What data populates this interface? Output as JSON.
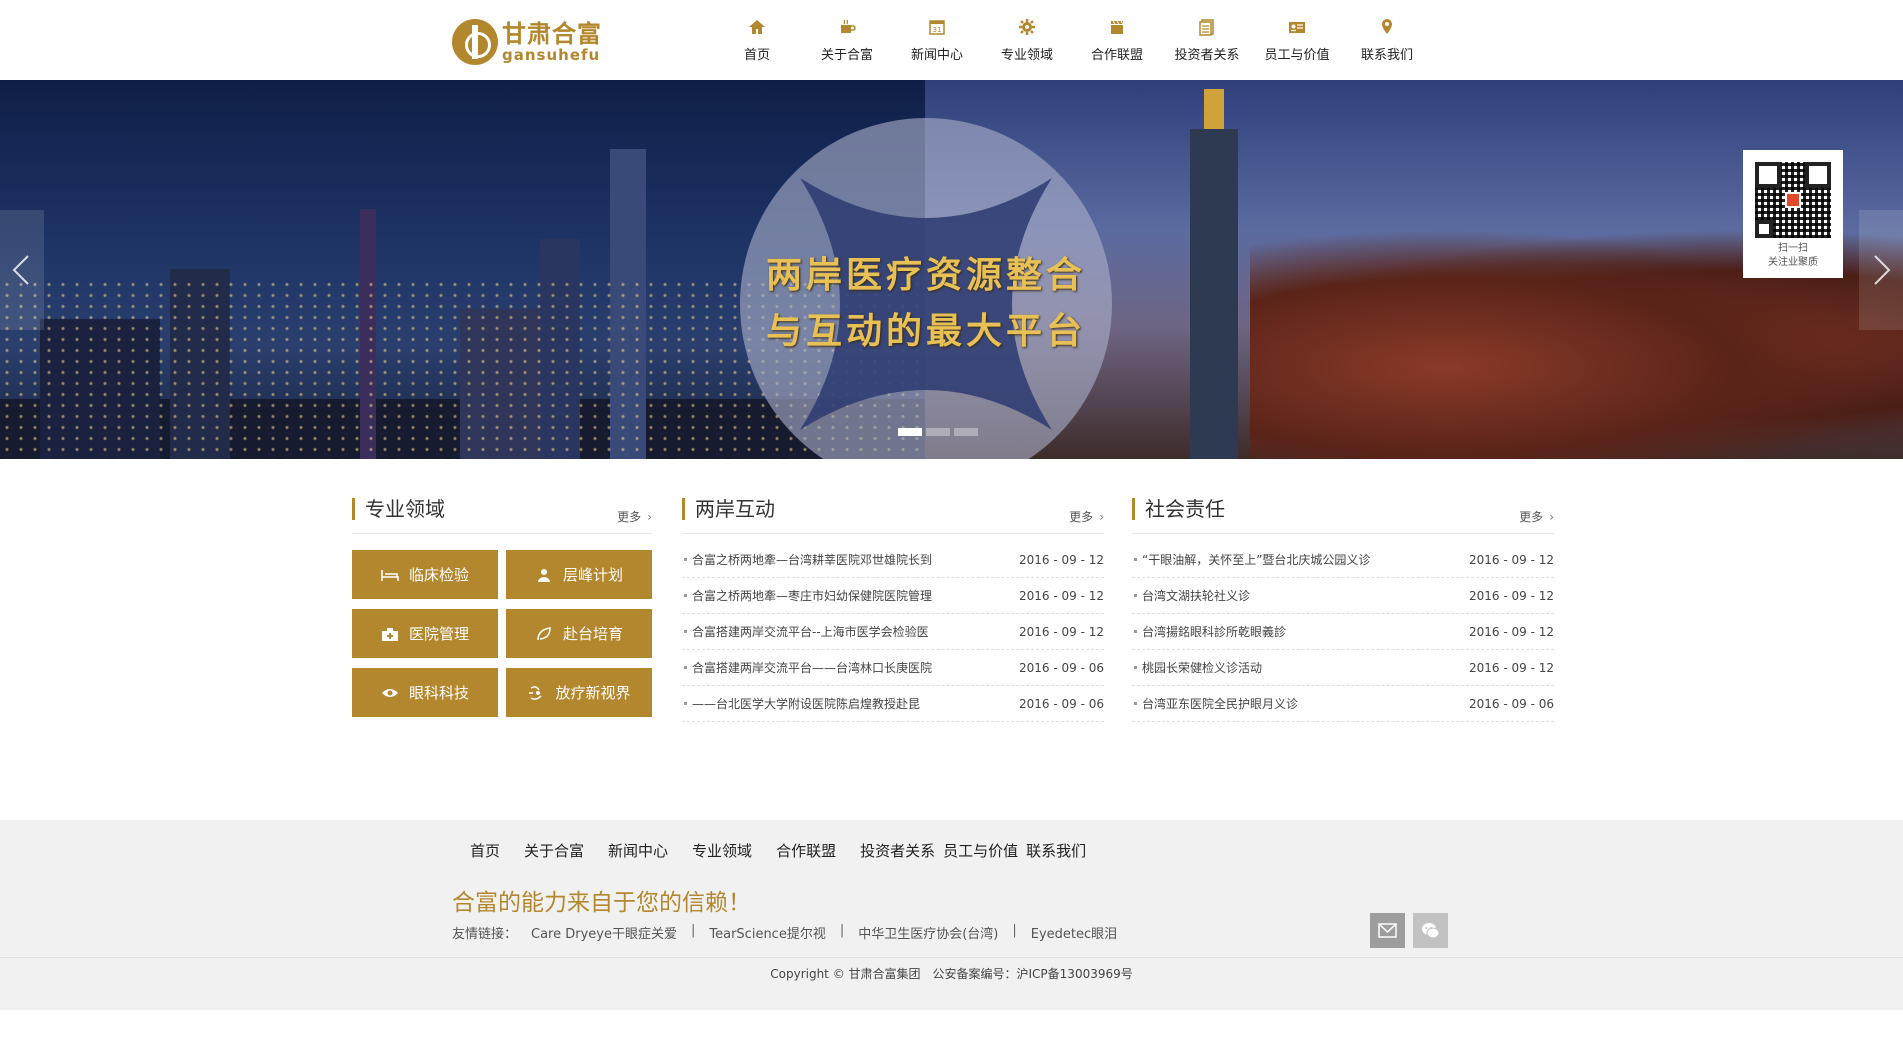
{
  "brand": {
    "name_cn": "甘肃合富",
    "name_en": "gansuhefu",
    "accent_color": "#b3872d"
  },
  "nav": {
    "items": [
      {
        "label": "首页",
        "icon": "home-icon"
      },
      {
        "label": "关于合富",
        "icon": "coffee-icon"
      },
      {
        "label": "新闻中心",
        "icon": "calendar-icon"
      },
      {
        "label": "专业领域",
        "icon": "gear-icon"
      },
      {
        "label": "合作联盟",
        "icon": "clapper-icon"
      },
      {
        "label": "投资者关系",
        "icon": "document-icon"
      },
      {
        "label": "员工与价值",
        "icon": "id-card-icon"
      },
      {
        "label": "联系我们",
        "icon": "map-pin-icon"
      }
    ]
  },
  "banner": {
    "slogan_line1": "两岸医疗资源整合",
    "slogan_line2": "与互动的最大平台",
    "qr_line1": "扫一扫",
    "qr_line2": "关注业聚质",
    "slides": 3,
    "active_slide": 1
  },
  "sections": {
    "fields": {
      "title": "专业领域",
      "more": "更多",
      "tiles": [
        {
          "label": "临床检验",
          "icon": "bed-icon"
        },
        {
          "label": "层峰计划",
          "icon": "user-icon"
        },
        {
          "label": "医院管理",
          "icon": "hospital-icon"
        },
        {
          "label": "赴台培育",
          "icon": "leaf-icon"
        },
        {
          "label": "眼科科技",
          "icon": "eye-icon"
        },
        {
          "label": "放疗新视界",
          "icon": "radiation-icon"
        }
      ]
    },
    "cross_strait": {
      "title": "两岸互动",
      "more": "更多",
      "items": [
        {
          "title": "合富之桥两地牽—台湾耕莘医院邓世雄院长到",
          "date": "2016 - 09 - 12"
        },
        {
          "title": "合富之桥两地牽—枣庄市妇幼保健院医院管理",
          "date": "2016 - 09 - 12"
        },
        {
          "title": "合富搭建两岸交流平台--上海市医学会检验医",
          "date": "2016 - 09 - 12"
        },
        {
          "title": "合富搭建两岸交流平台——台湾林口长庚医院",
          "date": "2016 - 09 - 06"
        },
        {
          "title": "——台北医学大学附设医院陈启煌教授赴昆",
          "date": "2016 - 09 - 06"
        }
      ]
    },
    "social": {
      "title": "社会责任",
      "more": "更多",
      "items": [
        {
          "title": "“干眼油解，关怀至上”暨台北庆城公园义诊",
          "date": "2016 - 09 - 12"
        },
        {
          "title": "台湾文湖扶轮社义诊",
          "date": "2016 - 09 - 12"
        },
        {
          "title": "台湾揚銘眼科診所乾眼義診",
          "date": "2016 - 09 - 12"
        },
        {
          "title": "桃园长荣健检义诊活动",
          "date": "2016 - 09 - 12"
        },
        {
          "title": "台湾亚东医院全民护眼月义诊",
          "date": "2016 - 09 - 06"
        }
      ]
    }
  },
  "footer": {
    "nav": [
      "首页",
      "关于合富",
      "新闻中心",
      "专业领域",
      "合作联盟",
      "投资者关系",
      "员工与价值",
      "联系我们"
    ],
    "slogan": "合富的能力来自于您的信赖！",
    "links_label": "友情链接：",
    "links": [
      "Care Dryeye干眼症关爱",
      "TearScience提尔视",
      "中华卫生医疗协会(台湾)",
      "Eyedetec眼泪"
    ],
    "copyright": "Copyright © 甘肃合富集团　公安备案编号：沪ICP备13003969号"
  }
}
